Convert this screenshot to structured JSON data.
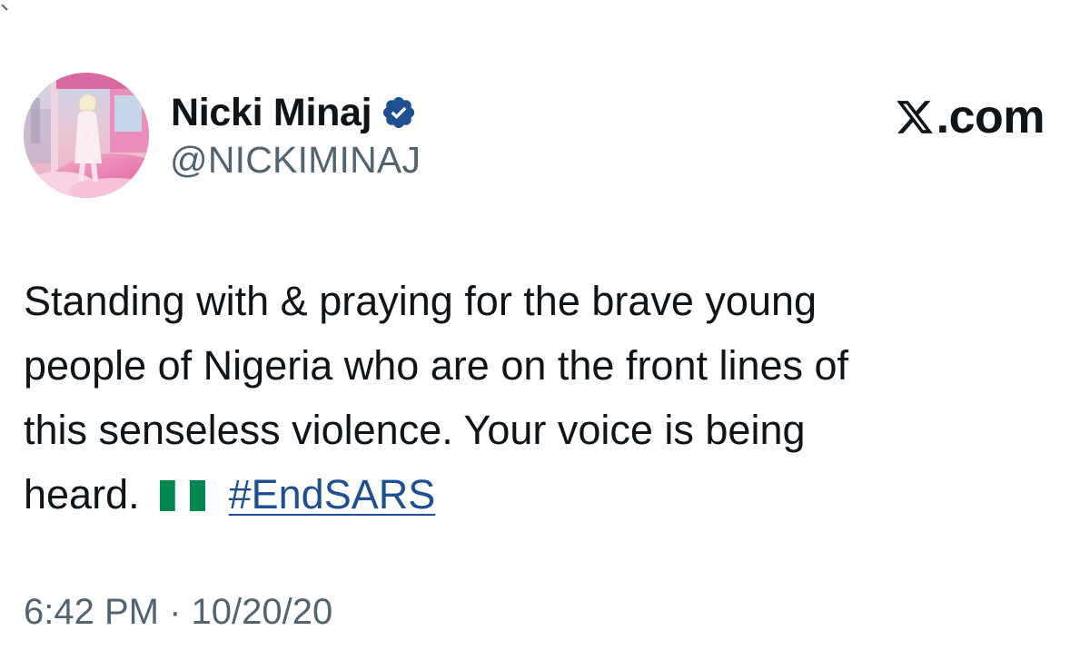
{
  "author": {
    "display_name": "Nicki Minaj",
    "handle": "@NICKIMINAJ",
    "verified_icon": "verified-badge-icon",
    "avatar_icon": "profile-avatar"
  },
  "brand": {
    "logo_icon": "x-logo-icon",
    "text": ".com"
  },
  "tweet": {
    "line1": "Standing with & praying for the brave young",
    "line2": "people of Nigeria who are on the front lines of",
    "line3": "this senseless violence. Your voice is being",
    "line4_prefix": "heard.",
    "flag_icon": "nigeria-flag-icon",
    "hashtag": "#EndSARS"
  },
  "meta": {
    "time": "6:42 PM",
    "separator": "·",
    "date": "10/20/20"
  },
  "colors": {
    "text": "#0f1419",
    "secondary": "#536471",
    "link": "#1d4f91",
    "verified": "#1d4f91",
    "flag_green": "#008751"
  }
}
